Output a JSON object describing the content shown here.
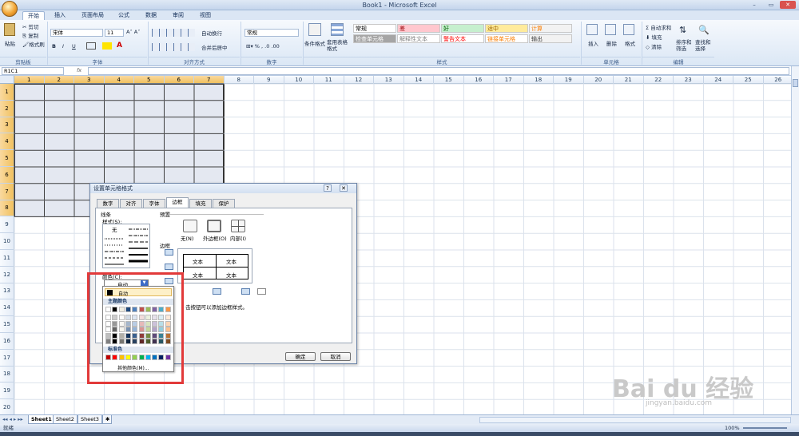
{
  "window": {
    "title": "Book1 - Microsoft Excel",
    "controls": [
      "–",
      "▭",
      "✕"
    ]
  },
  "tabs": [
    "开始",
    "插入",
    "页面布局",
    "公式",
    "数据",
    "审阅",
    "视图"
  ],
  "active_tab": "开始",
  "ribbon": {
    "clipboard": {
      "paste": "粘贴",
      "cut": "剪切",
      "copy": "复制",
      "format_painter": "格式刷",
      "label": "剪贴板"
    },
    "font": {
      "name": "宋体",
      "size": "11",
      "bold": "B",
      "italic": "I",
      "underline": "U",
      "label": "字体"
    },
    "align": {
      "wrap": "自动换行",
      "merge": "合并后居中",
      "label": "对齐方式"
    },
    "number": {
      "format": "常规",
      "label": "数字"
    },
    "styles": {
      "cond_format": "条件格式",
      "table_format": "套用表格格式",
      "cells": [
        [
          "常规",
          "差",
          "好",
          "适中",
          "计算"
        ],
        [
          "检查单元格",
          "解释性文本",
          "警告文本",
          "链接单元格",
          "输出"
        ]
      ],
      "label": "样式"
    },
    "cells": {
      "insert": "插入",
      "delete": "删除",
      "format": "格式",
      "label": "单元格"
    },
    "edit": {
      "autosum": "自动求和",
      "fill": "填充",
      "clear": "清除",
      "sort": "排序和筛选",
      "find": "查找和选择",
      "label": "编辑"
    }
  },
  "formula_bar": {
    "name_box": "R1C1",
    "fx": "fx"
  },
  "columns": [
    "1",
    "2",
    "3",
    "4",
    "5",
    "6",
    "7",
    "8",
    "9",
    "10",
    "11",
    "12",
    "13",
    "14",
    "15",
    "16",
    "17",
    "18",
    "19",
    "20",
    "21",
    "22",
    "23",
    "24",
    "25",
    "26"
  ],
  "rows": [
    "1",
    "2",
    "3",
    "4",
    "5",
    "6",
    "7",
    "8",
    "9",
    "10",
    "11",
    "12",
    "13",
    "14",
    "15",
    "16",
    "17",
    "18",
    "19",
    "20"
  ],
  "selected_cols": 7,
  "selected_rows": 8,
  "dialog": {
    "title": "设置单元格格式",
    "tabs": [
      "数字",
      "对齐",
      "字体",
      "边框",
      "填充",
      "保护"
    ],
    "active_tab": "边框",
    "line_label": "线条",
    "style_label": "样式(S):",
    "style_none": "无",
    "preset_label": "预置",
    "presets": [
      "无(N)",
      "外边框(O)",
      "内部(I)"
    ],
    "border_label": "边框",
    "preview_text": [
      "文本",
      "文本",
      "文本",
      "文本"
    ],
    "color_label": "颜色(C):",
    "color_value": "自动",
    "hint": "单击预置选项、预览草图及上面的按钮可以添加边框样式。",
    "hint_visible": "击按钮可以添加边框样式。",
    "ok": "确定",
    "cancel": "取消"
  },
  "color_popup": {
    "auto": "自动",
    "theme_header": "主题颜色",
    "standard_header": "标准色",
    "more": "其他颜色(M)...",
    "theme_colors": [
      "#ffffff",
      "#000000",
      "#eeece1",
      "#1f497d",
      "#4f81bd",
      "#c0504d",
      "#9bbb59",
      "#8064a2",
      "#4bacc6",
      "#f79646"
    ],
    "standard_colors": [
      "#c00000",
      "#ff0000",
      "#ffc000",
      "#ffff00",
      "#92d050",
      "#00b050",
      "#00b0f0",
      "#0070c0",
      "#002060",
      "#7030a0"
    ]
  },
  "sheets": [
    "Sheet1",
    "Sheet2",
    "Sheet3"
  ],
  "status": {
    "left": "就绪",
    "zoom": "100%"
  },
  "watermark": {
    "main": "Bai du 经验",
    "sub": "jingyan.baidu.com"
  }
}
